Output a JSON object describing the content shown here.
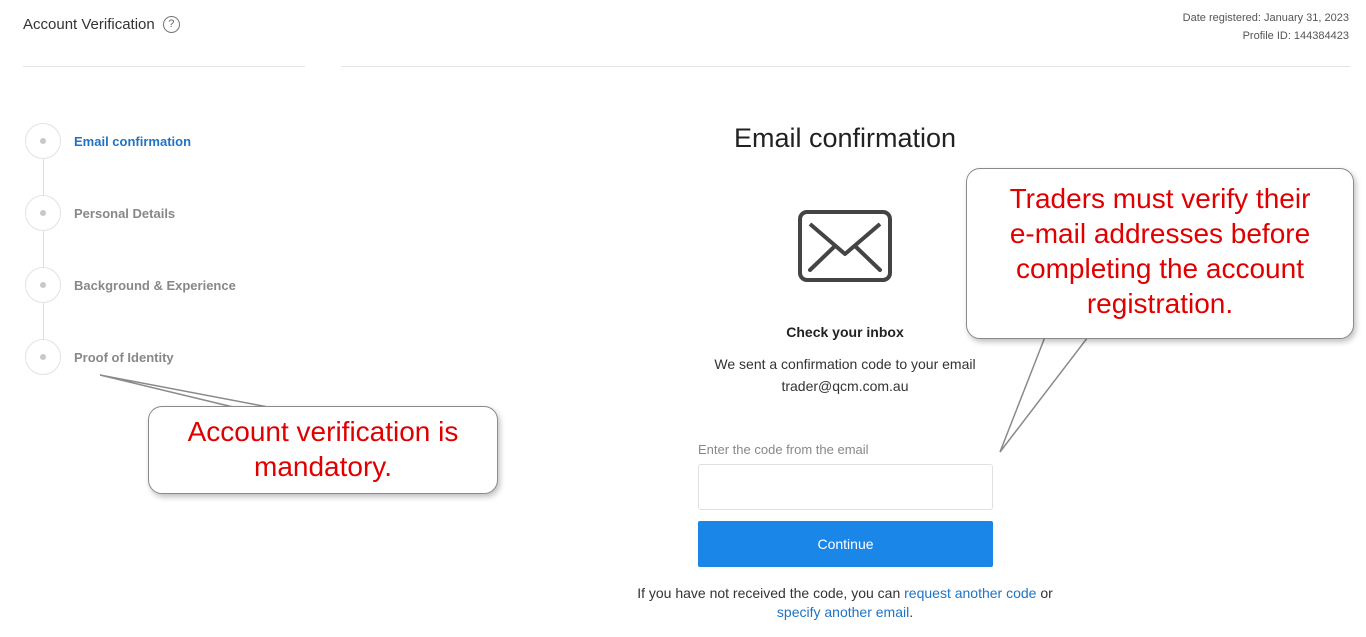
{
  "header": {
    "title": "Account Verification",
    "help_icon": "?",
    "date_registered": "Date registered: January 31, 2023",
    "profile_id": "Profile ID: 144384423"
  },
  "steps": [
    {
      "label": "Email confirmation",
      "active": true
    },
    {
      "label": "Personal Details",
      "active": false
    },
    {
      "label": "Background & Experience",
      "active": false
    },
    {
      "label": "Proof of Identity",
      "active": false
    }
  ],
  "main": {
    "title": "Email confirmation",
    "icon": "envelope-icon",
    "inbox_title": "Check your inbox",
    "sent_line1": "We sent a confirmation code to your email",
    "sent_line2": "trader@qcm.com.au",
    "code_label": "Enter the code from the email",
    "code_value": "",
    "continue_label": "Continue",
    "resend_prefix": "If you have not received the code, you can",
    "resend_link": "request another code",
    "resend_or": "or",
    "specify_link": "specify another email",
    "resend_suffix": "."
  },
  "callouts": {
    "verify_line1": "Traders must verify their",
    "verify_line2": "e-mail addresses before",
    "verify_line3": "completing the account",
    "verify_line4": "registration.",
    "mandatory_line1": "Account verification is",
    "mandatory_line2": "mandatory."
  },
  "colors": {
    "accent": "#1a87e8",
    "link": "#1f73c4",
    "callout_text": "#e00000"
  }
}
